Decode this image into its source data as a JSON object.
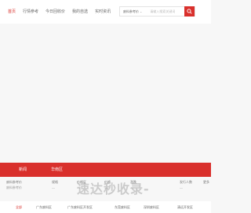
{
  "header": {
    "nav": [
      {
        "label": "首页",
        "active": true
      },
      {
        "label": "行情参考",
        "active": false
      },
      {
        "label": "今日回收价",
        "active": false
      },
      {
        "label": "我的自选",
        "active": false
      },
      {
        "label": "实时资讯",
        "active": false
      }
    ],
    "search": {
      "category": "废料参考价",
      "placeholder": "请输入搜索关键词"
    }
  },
  "colors": {
    "accent": "#d9302c",
    "background": "#f7f7f7"
  },
  "banner": {
    "tabs": [
      "新闻",
      "华南区"
    ]
  },
  "table": {
    "columns": [
      "废料参考价",
      "规格",
      "价格区",
      "价格",
      "涨跌",
      "",
      "",
      "",
      "发行人数",
      "更多"
    ],
    "row": [
      "废料参考价",
      "—",
      "—",
      "—",
      "—",
      "—"
    ]
  },
  "filters": {
    "items": [
      {
        "label": "全部",
        "active": true
      },
      {
        "label": "广东废料区",
        "active": false
      },
      {
        "label": "广东废料区开发区",
        "active": false
      },
      {
        "label": "东莞废料区",
        "active": false
      },
      {
        "label": "深圳废料区",
        "active": false
      },
      {
        "label": "清远开发区",
        "active": false
      }
    ]
  },
  "watermark": {
    "text": "速达秒收录-"
  }
}
